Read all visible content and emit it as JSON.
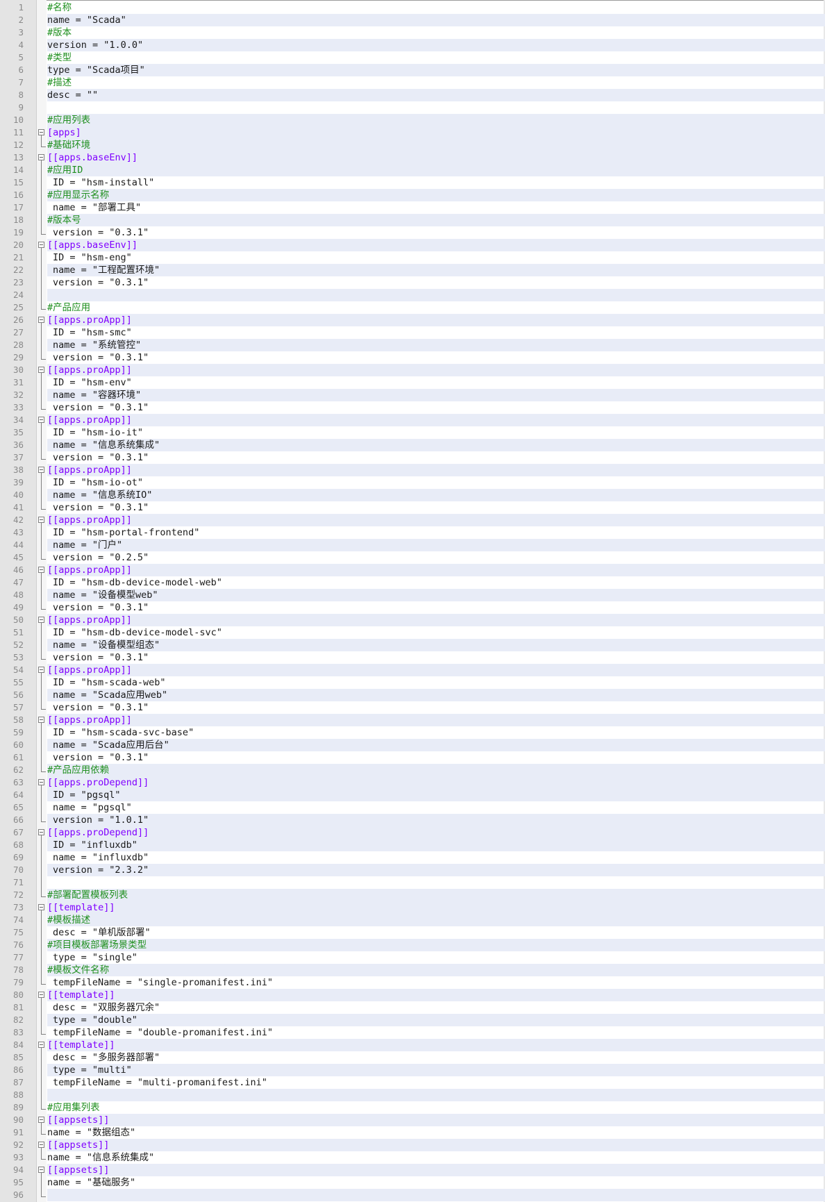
{
  "editor": {
    "lines": [
      {
        "n": "1",
        "text": "#名称",
        "kind": "comment",
        "indent": false,
        "fold": "none"
      },
      {
        "n": "2",
        "text": "name = \"Scada\"",
        "kind": "code",
        "indent": false,
        "fold": "none"
      },
      {
        "n": "3",
        "text": "#版本",
        "kind": "comment",
        "indent": false,
        "fold": "none"
      },
      {
        "n": "4",
        "text": "version = \"1.0.0\"",
        "kind": "code",
        "indent": false,
        "fold": "none"
      },
      {
        "n": "5",
        "text": "#类型",
        "kind": "comment",
        "indent": false,
        "fold": "none"
      },
      {
        "n": "6",
        "text": "type = \"Scada项目\"",
        "kind": "code",
        "indent": false,
        "fold": "none"
      },
      {
        "n": "7",
        "text": "#描述",
        "kind": "comment",
        "indent": false,
        "fold": "none"
      },
      {
        "n": "8",
        "text": "desc = \"\"",
        "kind": "code",
        "indent": false,
        "fold": "none"
      },
      {
        "n": "9",
        "text": "",
        "kind": "code",
        "indent": false,
        "fold": "none"
      },
      {
        "n": "10",
        "text": "#应用列表",
        "kind": "comment",
        "indent": false,
        "fold": "none"
      },
      {
        "n": "11",
        "text": "[apps]",
        "kind": "section",
        "indent": false,
        "fold": "box"
      },
      {
        "n": "12",
        "text": "#基础环境",
        "kind": "comment",
        "indent": false,
        "fold": "end"
      },
      {
        "n": "13",
        "text": "[[apps.baseEnv]]",
        "kind": "section",
        "indent": false,
        "fold": "box"
      },
      {
        "n": "14",
        "text": "#应用ID",
        "kind": "comment",
        "indent": false,
        "fold": "line"
      },
      {
        "n": "15",
        "text": "ID = \"hsm-install\"",
        "kind": "code",
        "indent": true,
        "fold": "line"
      },
      {
        "n": "16",
        "text": "#应用显示名称",
        "kind": "comment",
        "indent": false,
        "fold": "line"
      },
      {
        "n": "17",
        "text": "name = \"部署工具\"",
        "kind": "code",
        "indent": true,
        "fold": "line"
      },
      {
        "n": "18",
        "text": "#版本号",
        "kind": "comment",
        "indent": false,
        "fold": "line"
      },
      {
        "n": "19",
        "text": "version = \"0.3.1\"",
        "kind": "code",
        "indent": true,
        "fold": "end"
      },
      {
        "n": "20",
        "text": "[[apps.baseEnv]]",
        "kind": "section",
        "indent": false,
        "fold": "box"
      },
      {
        "n": "21",
        "text": "ID = \"hsm-eng\"",
        "kind": "code",
        "indent": true,
        "fold": "line"
      },
      {
        "n": "22",
        "text": "name = \"工程配置环境\"",
        "kind": "code",
        "indent": true,
        "fold": "line"
      },
      {
        "n": "23",
        "text": "version = \"0.3.1\"",
        "kind": "code",
        "indent": true,
        "fold": "line"
      },
      {
        "n": "24",
        "text": "",
        "kind": "code",
        "indent": false,
        "fold": "line"
      },
      {
        "n": "25",
        "text": "#产品应用",
        "kind": "comment",
        "indent": false,
        "fold": "end"
      },
      {
        "n": "26",
        "text": "[[apps.proApp]]",
        "kind": "section",
        "indent": false,
        "fold": "box"
      },
      {
        "n": "27",
        "text": "ID = \"hsm-smc\"",
        "kind": "code",
        "indent": true,
        "fold": "line"
      },
      {
        "n": "28",
        "text": "name = \"系统管控\"",
        "kind": "code",
        "indent": true,
        "fold": "line"
      },
      {
        "n": "29",
        "text": "version = \"0.3.1\"",
        "kind": "code",
        "indent": true,
        "fold": "end"
      },
      {
        "n": "30",
        "text": "[[apps.proApp]]",
        "kind": "section",
        "indent": false,
        "fold": "box"
      },
      {
        "n": "31",
        "text": "ID = \"hsm-env\"",
        "kind": "code",
        "indent": true,
        "fold": "line"
      },
      {
        "n": "32",
        "text": "name = \"容器环境\"",
        "kind": "code",
        "indent": true,
        "fold": "line"
      },
      {
        "n": "33",
        "text": "version = \"0.3.1\"",
        "kind": "code",
        "indent": true,
        "fold": "end"
      },
      {
        "n": "34",
        "text": "[[apps.proApp]]",
        "kind": "section",
        "indent": false,
        "fold": "box"
      },
      {
        "n": "35",
        "text": "ID = \"hsm-io-it\"",
        "kind": "code",
        "indent": true,
        "fold": "line"
      },
      {
        "n": "36",
        "text": "name = \"信息系统集成\"",
        "kind": "code",
        "indent": true,
        "fold": "line"
      },
      {
        "n": "37",
        "text": "version = \"0.3.1\"",
        "kind": "code",
        "indent": true,
        "fold": "end"
      },
      {
        "n": "38",
        "text": "[[apps.proApp]]",
        "kind": "section",
        "indent": false,
        "fold": "box"
      },
      {
        "n": "39",
        "text": "ID = \"hsm-io-ot\"",
        "kind": "code",
        "indent": true,
        "fold": "line"
      },
      {
        "n": "40",
        "text": "name = \"信息系统IO\"",
        "kind": "code",
        "indent": true,
        "fold": "line"
      },
      {
        "n": "41",
        "text": "version = \"0.3.1\"",
        "kind": "code",
        "indent": true,
        "fold": "end"
      },
      {
        "n": "42",
        "text": "[[apps.proApp]]",
        "kind": "section",
        "indent": false,
        "fold": "box"
      },
      {
        "n": "43",
        "text": "ID = \"hsm-portal-frontend\"",
        "kind": "code",
        "indent": true,
        "fold": "line"
      },
      {
        "n": "44",
        "text": "name = \"门户\"",
        "kind": "code",
        "indent": true,
        "fold": "line"
      },
      {
        "n": "45",
        "text": "version = \"0.2.5\"",
        "kind": "code",
        "indent": true,
        "fold": "end"
      },
      {
        "n": "46",
        "text": "[[apps.proApp]]",
        "kind": "section",
        "indent": false,
        "fold": "box"
      },
      {
        "n": "47",
        "text": "ID = \"hsm-db-device-model-web\"",
        "kind": "code",
        "indent": true,
        "fold": "line"
      },
      {
        "n": "48",
        "text": "name = \"设备模型web\"",
        "kind": "code",
        "indent": true,
        "fold": "line"
      },
      {
        "n": "49",
        "text": "version = \"0.3.1\"",
        "kind": "code",
        "indent": true,
        "fold": "end"
      },
      {
        "n": "50",
        "text": "[[apps.proApp]]",
        "kind": "section",
        "indent": false,
        "fold": "box"
      },
      {
        "n": "51",
        "text": "ID = \"hsm-db-device-model-svc\"",
        "kind": "code",
        "indent": true,
        "fold": "line"
      },
      {
        "n": "52",
        "text": "name = \"设备模型组态\"",
        "kind": "code",
        "indent": true,
        "fold": "line"
      },
      {
        "n": "53",
        "text": "version = \"0.3.1\"",
        "kind": "code",
        "indent": true,
        "fold": "end"
      },
      {
        "n": "54",
        "text": "[[apps.proApp]]",
        "kind": "section",
        "indent": false,
        "fold": "box"
      },
      {
        "n": "55",
        "text": "ID = \"hsm-scada-web\"",
        "kind": "code",
        "indent": true,
        "fold": "line"
      },
      {
        "n": "56",
        "text": "name = \"Scada应用web\"",
        "kind": "code",
        "indent": true,
        "fold": "line"
      },
      {
        "n": "57",
        "text": "version = \"0.3.1\"",
        "kind": "code",
        "indent": true,
        "fold": "end"
      },
      {
        "n": "58",
        "text": "[[apps.proApp]]",
        "kind": "section",
        "indent": false,
        "fold": "box"
      },
      {
        "n": "59",
        "text": "ID = \"hsm-scada-svc-base\"",
        "kind": "code",
        "indent": true,
        "fold": "line"
      },
      {
        "n": "60",
        "text": "name = \"Scada应用后台\"",
        "kind": "code",
        "indent": true,
        "fold": "line"
      },
      {
        "n": "61",
        "text": "version = \"0.3.1\"",
        "kind": "code",
        "indent": true,
        "fold": "line"
      },
      {
        "n": "62",
        "text": "#产品应用依赖",
        "kind": "comment",
        "indent": false,
        "fold": "end"
      },
      {
        "n": "63",
        "text": "[[apps.proDepend]]",
        "kind": "section",
        "indent": false,
        "fold": "box"
      },
      {
        "n": "64",
        "text": "ID = \"pgsql\"",
        "kind": "code",
        "indent": true,
        "fold": "line"
      },
      {
        "n": "65",
        "text": "name = \"pgsql\"",
        "kind": "code",
        "indent": true,
        "fold": "line"
      },
      {
        "n": "66",
        "text": "version = \"1.0.1\"",
        "kind": "code",
        "indent": true,
        "fold": "end"
      },
      {
        "n": "67",
        "text": "[[apps.proDepend]]",
        "kind": "section",
        "indent": false,
        "fold": "box"
      },
      {
        "n": "68",
        "text": "ID = \"influxdb\"",
        "kind": "code",
        "indent": true,
        "fold": "line"
      },
      {
        "n": "69",
        "text": "name = \"influxdb\"",
        "kind": "code",
        "indent": true,
        "fold": "line"
      },
      {
        "n": "70",
        "text": "version = \"2.3.2\"",
        "kind": "code",
        "indent": true,
        "fold": "line"
      },
      {
        "n": "71",
        "text": "",
        "kind": "code",
        "indent": false,
        "fold": "line"
      },
      {
        "n": "72",
        "text": "#部署配置模板列表",
        "kind": "comment",
        "indent": false,
        "fold": "end"
      },
      {
        "n": "73",
        "text": "[[template]]",
        "kind": "section",
        "indent": false,
        "fold": "box"
      },
      {
        "n": "74",
        "text": "#模板描述",
        "kind": "comment",
        "indent": false,
        "fold": "line"
      },
      {
        "n": "75",
        "text": "desc = \"单机版部署\"",
        "kind": "code",
        "indent": true,
        "fold": "line"
      },
      {
        "n": "76",
        "text": "#项目模板部署场景类型",
        "kind": "comment",
        "indent": false,
        "fold": "line"
      },
      {
        "n": "77",
        "text": "type = \"single\"",
        "kind": "code",
        "indent": true,
        "fold": "line"
      },
      {
        "n": "78",
        "text": "#模板文件名称",
        "kind": "comment",
        "indent": false,
        "fold": "line"
      },
      {
        "n": "79",
        "text": "tempFileName = \"single-promanifest.ini\"",
        "kind": "code",
        "indent": true,
        "fold": "end"
      },
      {
        "n": "80",
        "text": "[[template]]",
        "kind": "section",
        "indent": false,
        "fold": "box"
      },
      {
        "n": "81",
        "text": "desc = \"双服务器冗余\"",
        "kind": "code",
        "indent": true,
        "fold": "line"
      },
      {
        "n": "82",
        "text": "type = \"double\"",
        "kind": "code",
        "indent": true,
        "fold": "line"
      },
      {
        "n": "83",
        "text": "tempFileName = \"double-promanifest.ini\"",
        "kind": "code",
        "indent": true,
        "fold": "end"
      },
      {
        "n": "84",
        "text": "[[template]]",
        "kind": "section",
        "indent": false,
        "fold": "box"
      },
      {
        "n": "85",
        "text": "desc = \"多服务器部署\"",
        "kind": "code",
        "indent": true,
        "fold": "line"
      },
      {
        "n": "86",
        "text": "type = \"multi\"",
        "kind": "code",
        "indent": true,
        "fold": "line"
      },
      {
        "n": "87",
        "text": "tempFileName = \"multi-promanifest.ini\"",
        "kind": "code",
        "indent": true,
        "fold": "line"
      },
      {
        "n": "88",
        "text": "",
        "kind": "code",
        "indent": false,
        "fold": "line"
      },
      {
        "n": "89",
        "text": "#应用集列表",
        "kind": "comment",
        "indent": false,
        "fold": "end"
      },
      {
        "n": "90",
        "text": "[[appsets]]",
        "kind": "section",
        "indent": false,
        "fold": "box"
      },
      {
        "n": "91",
        "text": "name = \"数据组态\"",
        "kind": "code",
        "indent": false,
        "fold": "end"
      },
      {
        "n": "92",
        "text": "[[appsets]]",
        "kind": "section",
        "indent": false,
        "fold": "box"
      },
      {
        "n": "93",
        "text": "name = \"信息系统集成\"",
        "kind": "code",
        "indent": false,
        "fold": "end"
      },
      {
        "n": "94",
        "text": "[[appsets]]",
        "kind": "section",
        "indent": false,
        "fold": "box"
      },
      {
        "n": "95",
        "text": "name = \"基础服务\"",
        "kind": "code",
        "indent": false,
        "fold": "line"
      },
      {
        "n": "96",
        "text": "",
        "kind": "code",
        "indent": false,
        "fold": "end"
      }
    ],
    "highlight_color": "#e8ecf7",
    "comment_color": "#1f8f1f",
    "section_color": "#8000ff"
  }
}
